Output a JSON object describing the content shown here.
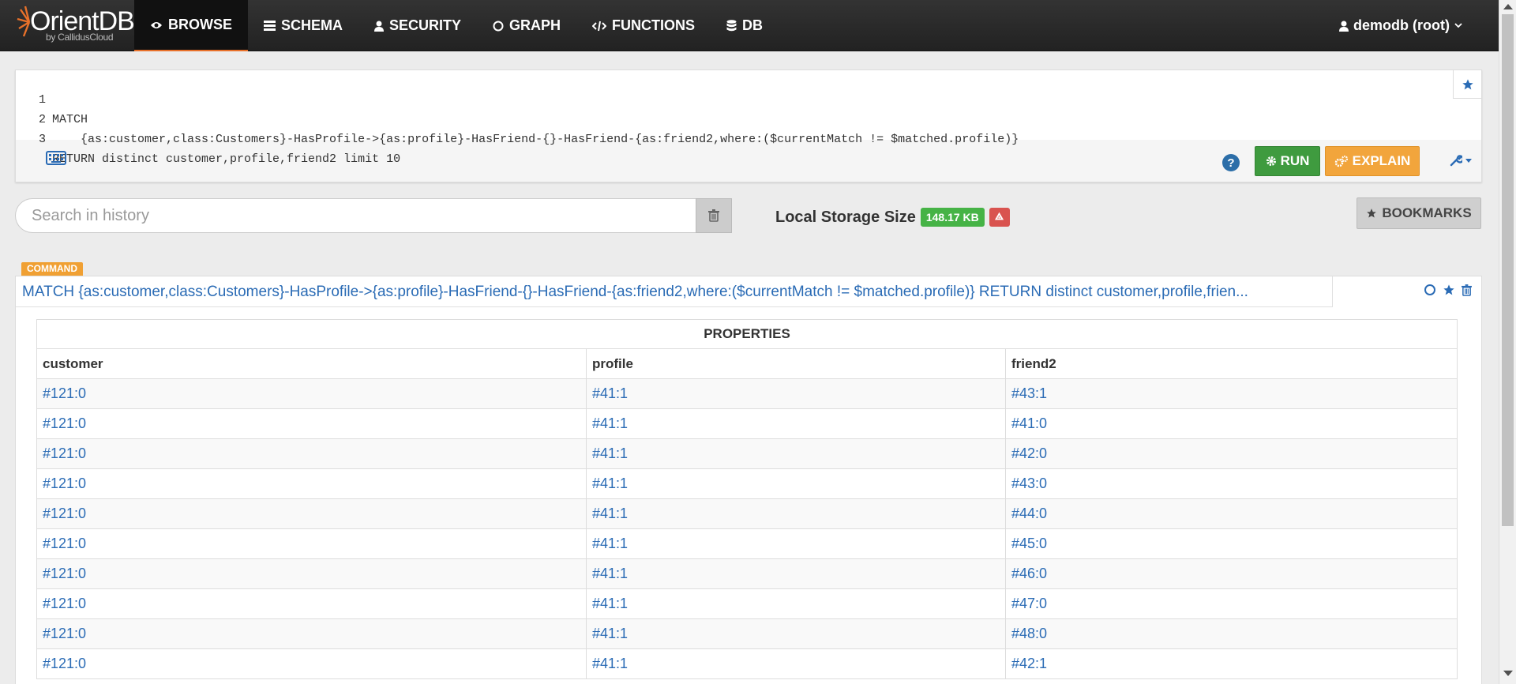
{
  "brand": {
    "name": "OrientDB",
    "tagline": "by CallidusCloud"
  },
  "nav": {
    "items": [
      {
        "label": "BROWSE",
        "icon": "eye-icon",
        "active": true
      },
      {
        "label": "SCHEMA",
        "icon": "list-icon"
      },
      {
        "label": "SECURITY",
        "icon": "user-icon"
      },
      {
        "label": "GRAPH",
        "icon": "circle-icon"
      },
      {
        "label": "FUNCTIONS",
        "icon": "code-icon"
      },
      {
        "label": "DB",
        "icon": "database-icon"
      }
    ],
    "user": "demodb (root)"
  },
  "editor": {
    "lines": [
      {
        "num": "1",
        "text": "MATCH"
      },
      {
        "num": "2",
        "text": "    {as:customer,class:Customers}-HasProfile->{as:profile}-HasFriend-{}-HasFriend-{as:friend2,where:($currentMatch != $matched.profile)}"
      },
      {
        "num": "3",
        "text": "RETURN distinct customer,profile,friend2 limit 10"
      }
    ],
    "run_label": "RUN",
    "explain_label": "EXPLAIN",
    "help_label": "?"
  },
  "history": {
    "search_placeholder": "Search in history",
    "storage_label": "Local Storage Size",
    "storage_size": "148.17 KB",
    "bookmarks_label": "BOOKMARKS"
  },
  "result": {
    "badge": "COMMAND",
    "query": "MATCH {as:customer,class:Customers}-HasProfile->{as:profile}-HasFriend-{}-HasFriend-{as:friend2,where:($currentMatch != $matched.profile)} RETURN distinct customer,profile,frien...",
    "table": {
      "group_header": "PROPERTIES",
      "columns": [
        "customer",
        "profile",
        "friend2"
      ],
      "rows": [
        [
          "#121:0",
          "#41:1",
          "#43:1"
        ],
        [
          "#121:0",
          "#41:1",
          "#41:0"
        ],
        [
          "#121:0",
          "#41:1",
          "#42:0"
        ],
        [
          "#121:0",
          "#41:1",
          "#43:0"
        ],
        [
          "#121:0",
          "#41:1",
          "#44:0"
        ],
        [
          "#121:0",
          "#41:1",
          "#45:0"
        ],
        [
          "#121:0",
          "#41:1",
          "#46:0"
        ],
        [
          "#121:0",
          "#41:1",
          "#47:0"
        ],
        [
          "#121:0",
          "#41:1",
          "#48:0"
        ],
        [
          "#121:0",
          "#41:1",
          "#42:1"
        ]
      ]
    }
  },
  "colors": {
    "accent": "#e8712a",
    "link": "#2a6bb5",
    "run": "#3f9b3f",
    "explain": "#f2a53c",
    "badge_green": "#46b346",
    "danger": "#d9534f"
  }
}
